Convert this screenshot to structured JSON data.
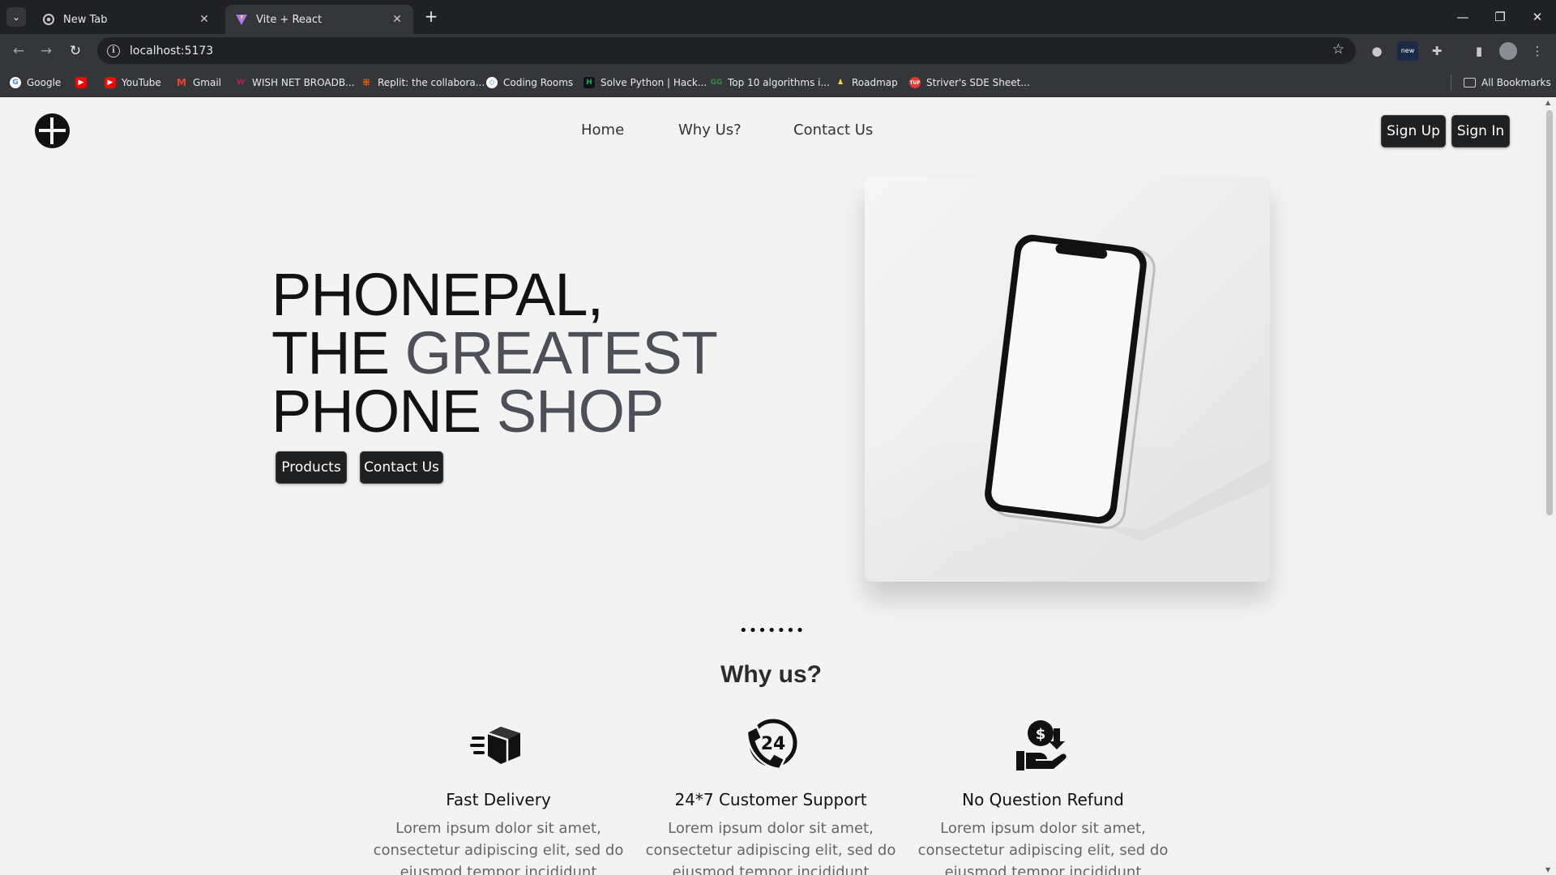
{
  "browser": {
    "tabs": [
      {
        "title": "New Tab",
        "active": false
      },
      {
        "title": "Vite + React",
        "active": true
      }
    ],
    "url": "localhost:5173",
    "bookmarks": [
      {
        "label": "Google",
        "icon": "google-icon",
        "color": "#ffffff"
      },
      {
        "label": "",
        "icon": "youtube-icon",
        "color": "#ff0000"
      },
      {
        "label": "YouTube",
        "icon": "youtube-icon",
        "color": "#ff0000"
      },
      {
        "label": "Gmail",
        "icon": "gmail-icon",
        "color": "#ea4335"
      },
      {
        "label": "WISH NET BROADB...",
        "icon": "wishnet-icon",
        "color": "#c2185b"
      },
      {
        "label": "Replit: the collabora...",
        "icon": "replit-icon",
        "color": "#f26207"
      },
      {
        "label": "Coding Rooms",
        "icon": "coding-rooms-icon",
        "color": "#ffffff"
      },
      {
        "label": "Solve Python | Hack...",
        "icon": "hackerrank-icon",
        "color": "#1ba94c"
      },
      {
        "label": "Top 10 algorithms i...",
        "icon": "gfg-icon",
        "color": "#2f8d46"
      },
      {
        "label": "Roadmap",
        "icon": "roadmap-icon",
        "color": "#ffd43b"
      },
      {
        "label": "Striver's SDE Sheet...",
        "icon": "tuf-icon",
        "color": "#e53935"
      }
    ],
    "all_bookmarks": "All Bookmarks"
  },
  "site": {
    "nav": [
      "Home",
      "Why Us?",
      "Contact Us"
    ],
    "signup": "Sign Up",
    "signin": "Sign In",
    "hero": {
      "line1": {
        "dark": "PHONEPAL,",
        "grey": ""
      },
      "line2": {
        "dark": "THE ",
        "grey": "GREATEST"
      },
      "line3": {
        "dark": "PHONE ",
        "grey": "SHOP"
      },
      "products_btn": "Products",
      "contact_btn": "Contact Us"
    },
    "dots": "•••••••",
    "why_title": "Why us?",
    "features": [
      {
        "icon": "delivery-box-icon",
        "title": "Fast Delivery",
        "desc1": "Lorem ipsum dolor sit amet,",
        "desc2": "consectetur adipiscing elit, sed do",
        "desc3": "eiusmod tempor incididunt"
      },
      {
        "icon": "support-24-icon",
        "title": "24*7 Customer Support",
        "desc1": "Lorem ipsum dolor sit amet,",
        "desc2": "consectetur adipiscing elit, sed do",
        "desc3": "eiusmod tempor incididunt"
      },
      {
        "icon": "refund-hand-icon",
        "title": "No Question Refund",
        "desc1": "Lorem ipsum dolor sit amet,",
        "desc2": "consectetur adipiscing elit, sed do",
        "desc3": "eiusmod tempor incididunt"
      }
    ]
  }
}
